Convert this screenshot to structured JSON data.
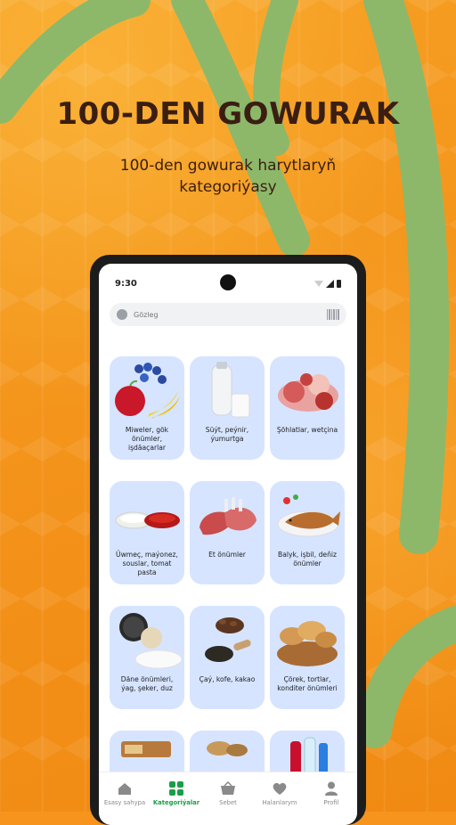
{
  "promo": {
    "title": "100-DEN GOWURAK",
    "subtitle_line1": "100-den gowurak harytlaryň",
    "subtitle_line2": "kategoriýasy"
  },
  "status_bar": {
    "time": "9:30"
  },
  "search": {
    "placeholder": "Gözleg"
  },
  "categories": [
    {
      "label": "Miweler, gök önümler, işdäaçarlar",
      "icon": "fruits-icon"
    },
    {
      "label": "Süýt, peýnir, ýumurtga",
      "icon": "milk-icon"
    },
    {
      "label": "Şöhlatlar, wetçina",
      "icon": "sausage-icon"
    },
    {
      "label": "Üwmeç, maýonez, souslar, tomat pasta",
      "icon": "sauce-icon"
    },
    {
      "label": "Et önümler",
      "icon": "meat-icon"
    },
    {
      "label": "Balyk, işbil, deňiz önümler",
      "icon": "fish-icon"
    },
    {
      "label": "Däne önümleri, ýag, şeker, duz",
      "icon": "grains-icon"
    },
    {
      "label": "Çaý, kofe, kakao",
      "icon": "tea-coffee-icon"
    },
    {
      "label": "Çörek, tortlar, konditer önümleri",
      "icon": "bread-icon"
    },
    {
      "label": "",
      "icon": "sweets-icon"
    },
    {
      "label": "",
      "icon": "nuts-icon"
    },
    {
      "label": "",
      "icon": "drinks-icon"
    }
  ],
  "nav": {
    "home": "Esasy sahypa",
    "categories": "Kategoriýalar",
    "cart": "Sebet",
    "favorites": "Halanlarym",
    "profile": "Profil"
  },
  "colors": {
    "background": "#f7941d",
    "swoosh": "#8db86a",
    "card": "#d6e4ff",
    "accent": "#1a9e46",
    "title": "#3a1e12"
  }
}
